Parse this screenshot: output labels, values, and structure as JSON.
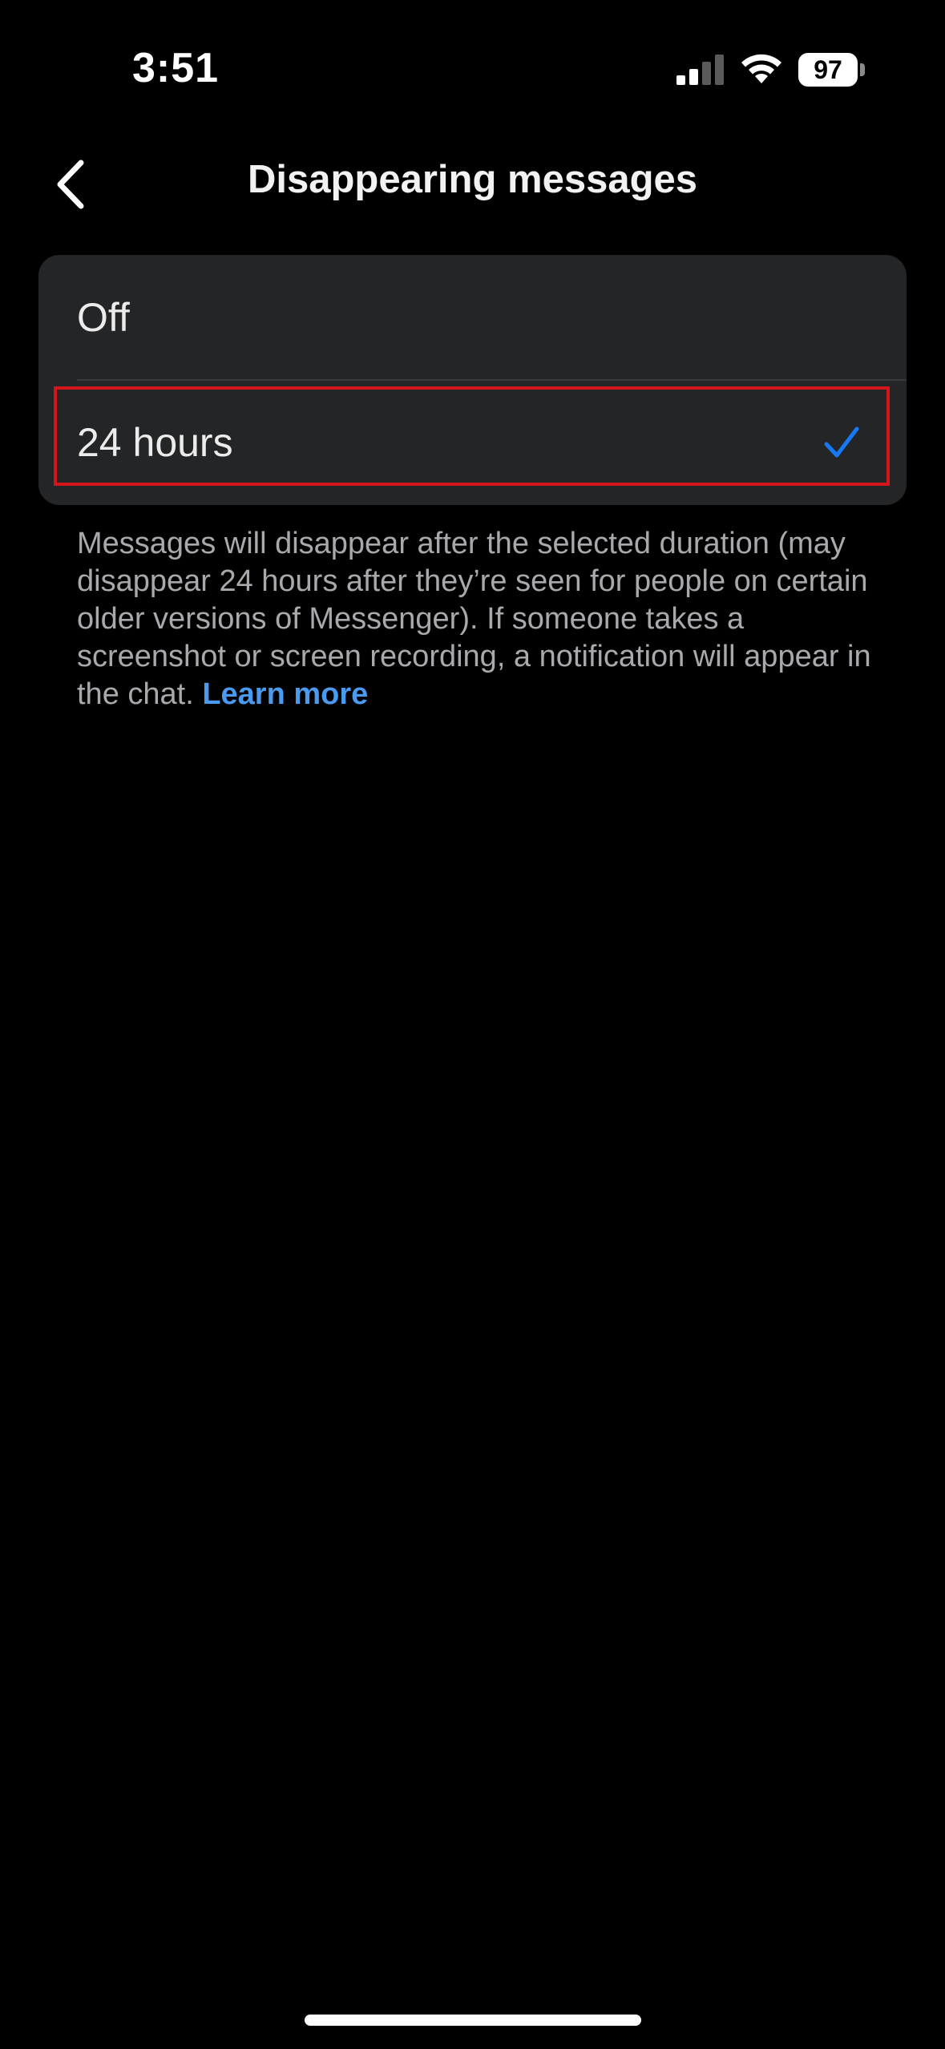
{
  "status_bar": {
    "time": "3:51",
    "battery_level": "97",
    "signal_bars": 2,
    "signal_bars_total": 4,
    "icons": [
      "signal-icon",
      "wifi-icon",
      "battery-icon"
    ]
  },
  "header": {
    "title": "Disappearing messages",
    "back_icon": "chevron-left-icon"
  },
  "options": [
    {
      "label": "Off",
      "selected": false
    },
    {
      "label": "24 hours",
      "selected": true,
      "highlighted": true
    }
  ],
  "description": {
    "text": "Messages will disappear after the selected duration (may disappear 24 hours after they’re seen for people on certain older versions of Messenger). If someone takes a screenshot or screen recording, a notification will appear in the chat. ",
    "link_text": "Learn more"
  },
  "colors": {
    "background": "#000000",
    "card": "#242527",
    "accent": "#1877f2",
    "link": "#4a9af0",
    "highlight": "#d4151b",
    "secondary_text": "#a9a9ad"
  }
}
